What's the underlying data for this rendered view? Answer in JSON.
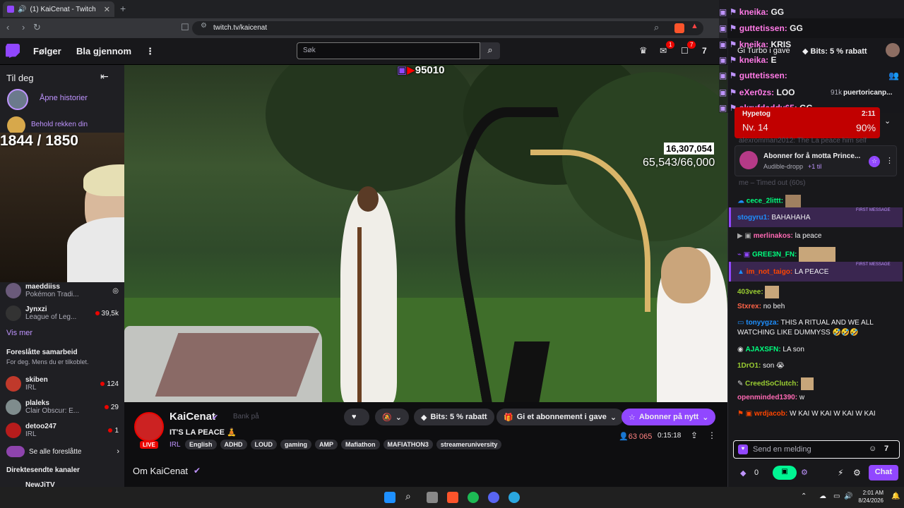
{
  "browser": {
    "tab_title": "(1) KaiCenat - Twitch",
    "url": "twitch.tv/kaicenat"
  },
  "nav": {
    "following": "Følger",
    "browse": "Bla gjennom",
    "search_placeholder": "Søk",
    "inbox_count": "1",
    "notif_count": "7",
    "turbo": "Gi Turbo i gave",
    "bits_discount": "Bits: 5 % rabatt"
  },
  "sidebar": {
    "for_you": "Til deg",
    "stories": "Åpne historier",
    "streak": "Behold rekken din",
    "channels": [
      {
        "name": "maeddiiss",
        "game": "Pokémon Tradi...",
        "count": ""
      },
      {
        "name": "Jynxzi",
        "game": "League of Leg...",
        "count": "39,5k"
      }
    ],
    "show_more": "Vis mer",
    "collab_title": "Foreslåtte samarbeid",
    "collab_sub": "For deg. Mens du er tilkoblet.",
    "collabs": [
      {
        "name": "skiben",
        "game": "IRL",
        "count": "124"
      },
      {
        "name": "plaleks",
        "game": "Clair Obscur: E...",
        "count": "29"
      },
      {
        "name": "detoo247",
        "game": "IRL",
        "count": "1"
      }
    ],
    "see_all": "Se alle foreslåtte",
    "live_title": "Direktesendte kanaler",
    "partial": "NewJiTV"
  },
  "video": {
    "yt_count": "95010",
    "sub_count": "1844 / 1850",
    "views": "16,307,054",
    "subs": "65,543/66,000"
  },
  "stream": {
    "channel": "KaiCenat",
    "title": "IT'S LA PEACE 🧘",
    "live": "LIVE",
    "category": "IRL",
    "tags": [
      "English",
      "ADHD",
      "LOUD",
      "gaming",
      "AMP",
      "Mafiathon",
      "MAFIATHON3",
      "streameruniversity"
    ],
    "bank": "Bank på",
    "bits": "Bits: 5 % rabatt",
    "gift_sub": "Gi et abonnement i gave",
    "resub": "Abonner på nytt",
    "viewers": "63 065",
    "uptime": "0:15:18",
    "about": "Om KaiCenat"
  },
  "chat": {
    "top": [
      {
        "user": "kneika:",
        "text": "GG"
      },
      {
        "user": "guttetissen:",
        "text": "GG"
      },
      {
        "user": "kneika:",
        "text": "KRIS"
      },
      {
        "user": "kneika:",
        "text": "E"
      },
      {
        "user": "guttetissen:",
        "text": ""
      },
      {
        "user": "eXer0zs:",
        "text": "LOO"
      },
      {
        "user": "skrufdaddy65:",
        "text": "GG"
      }
    ],
    "header_partial": "puertoricanp...",
    "count_partial": "91k",
    "hype_label": "Hypetog",
    "hype_level": "Nv. 14",
    "hype_time": "2:11",
    "hype_pct": "90%",
    "promo_title": "Abonner for å motta Prince...",
    "promo_sub": "Audible-dropp",
    "promo_more": "+1 til",
    "faded": "alexromman2012: The La peace him self",
    "timed_out": "me – Timed out (60s)",
    "messages": [
      {
        "user": "cece_2littt:",
        "text": "",
        "color": "#00ff7f"
      },
      {
        "user": "stogyru1:",
        "text": "BAHAHAHA",
        "color": "#1e90ff",
        "first": "FIRST MESSAGE"
      },
      {
        "user": "merlinakos:",
        "text": "la peace",
        "color": "#ff69b4"
      },
      {
        "user": "GREE3N_FN:",
        "text": "",
        "color": "#00ff7f"
      },
      {
        "user": "im_not_taigo:",
        "text": "LA PEACE",
        "color": "#ff4500",
        "first": "FIRST MESSAGE"
      },
      {
        "user": "403vee:",
        "text": "",
        "color": "#9acd32"
      },
      {
        "user": "Stxrex:",
        "text": "no beh",
        "color": "#ff6347"
      },
      {
        "user": "tonyygza:",
        "text": "THIS A RITUAL AND WE ALL WATCHING LIKE DUMMYSS 🤣🤣🤣",
        "color": "#1e90ff"
      },
      {
        "user": "AJAXSFN:",
        "text": "LA son",
        "color": "#00ff7f"
      },
      {
        "user": "1DrO1:",
        "text": "son 😭",
        "color": "#9acd32"
      },
      {
        "user": "CreedSoClutch:",
        "text": "",
        "color": "#9acd32"
      },
      {
        "user": "openminded1390:",
        "text": "w",
        "color": "#ff69b4"
      },
      {
        "user": "wrdjacob:",
        "text": "W KAI W KAI W KAI W KAI",
        "color": "#ff4500"
      }
    ],
    "input_placeholder": "Send en melding",
    "points": "0",
    "chat_button": "Chat"
  },
  "taskbar": {
    "time": "2:01 AM",
    "date": "8/24/2026"
  }
}
